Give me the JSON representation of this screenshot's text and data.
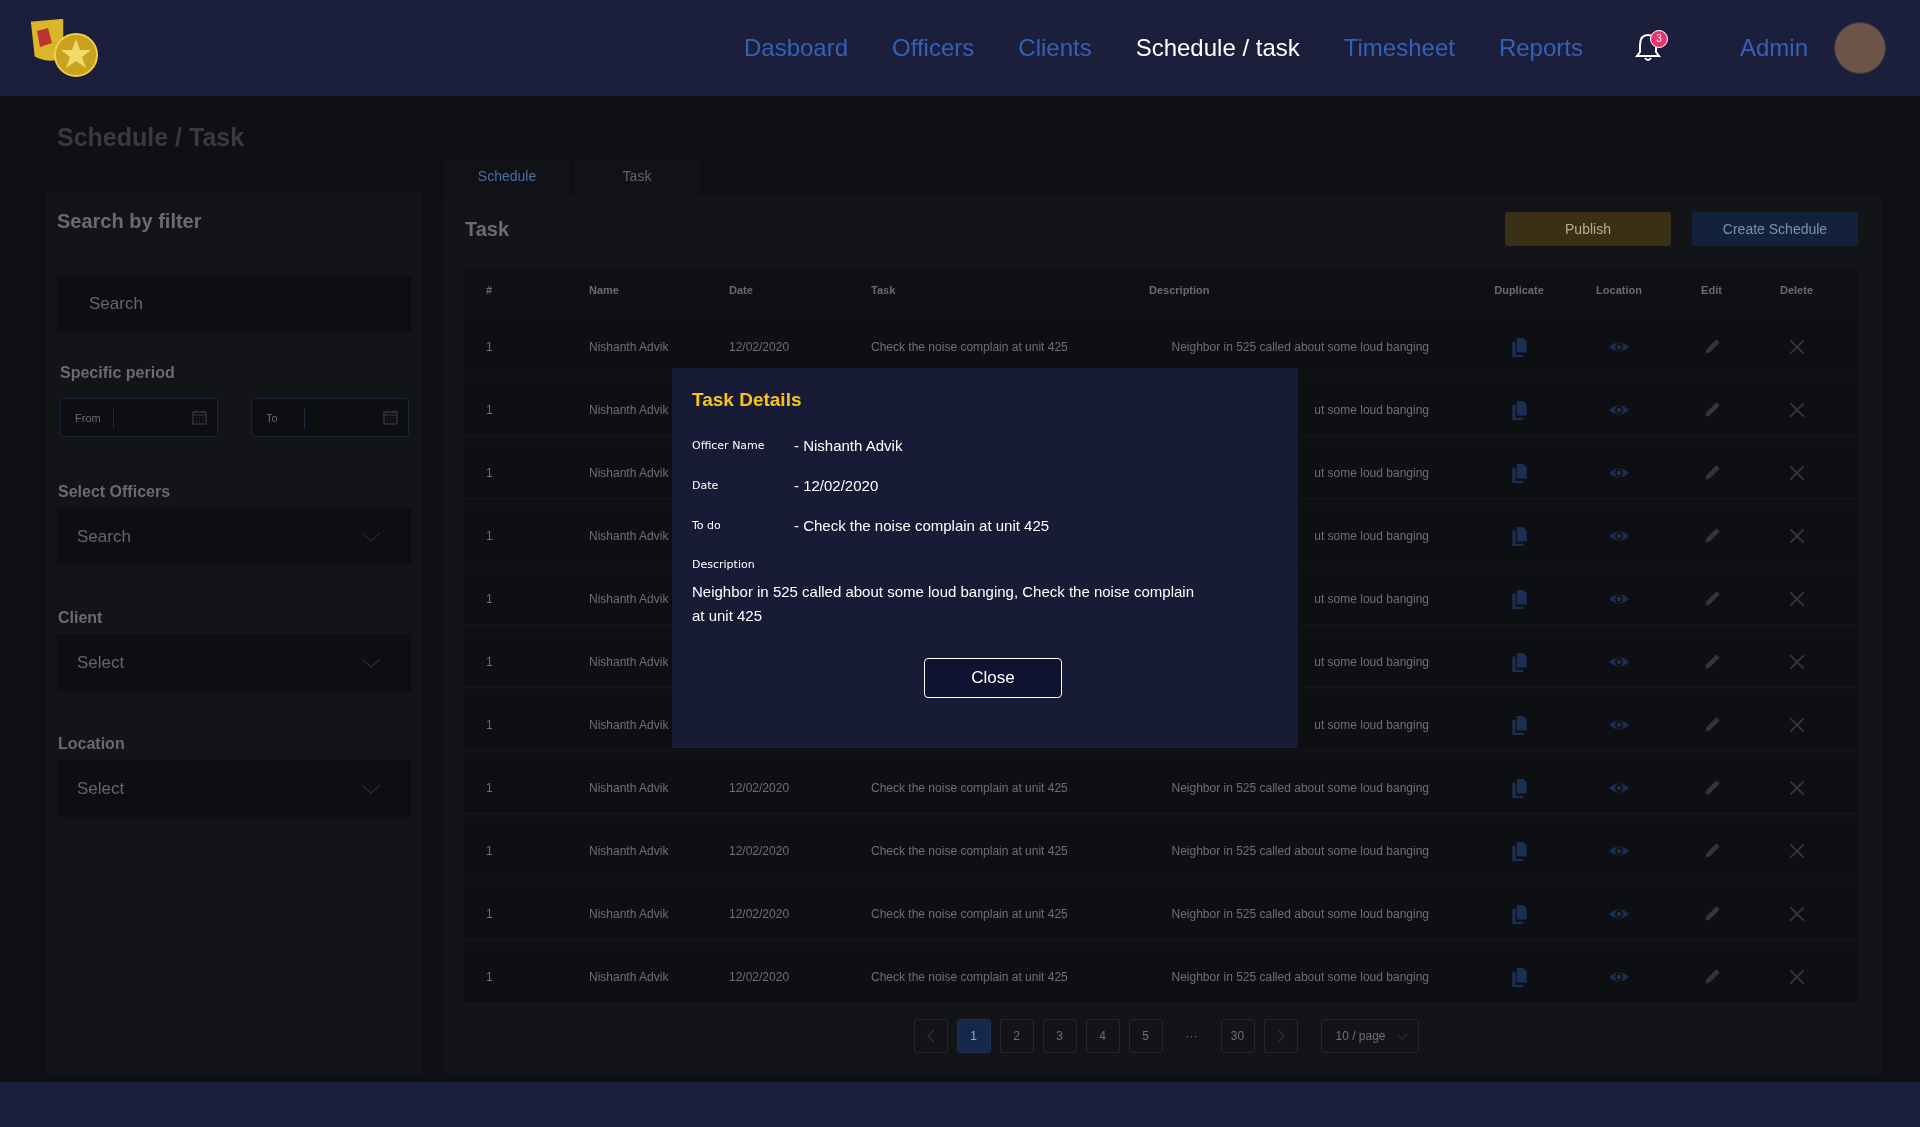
{
  "header": {
    "nav": [
      {
        "label": "Dasboard",
        "selected": false
      },
      {
        "label": "Officers",
        "selected": false
      },
      {
        "label": "Clients",
        "selected": false
      },
      {
        "label": "Schedule / task",
        "selected": true
      },
      {
        "label": "Timesheet",
        "selected": false
      },
      {
        "label": "Reports",
        "selected": false
      }
    ],
    "notifications": "3",
    "user": "Admin"
  },
  "page_title": "Schedule / Task",
  "filters": {
    "title": "Search by filter",
    "search": {
      "placeholder": "Search"
    },
    "period": {
      "label": "Specific period",
      "from": {
        "placeholder": "From"
      },
      "to": {
        "placeholder": "To"
      }
    },
    "selects": [
      {
        "label": "Select Officers",
        "placeholder": "Search"
      },
      {
        "label": "Client",
        "placeholder": "Select"
      },
      {
        "label": "Location",
        "placeholder": "Select"
      }
    ]
  },
  "tabs": [
    {
      "label": "Schedule",
      "selected": true
    },
    {
      "label": "Task",
      "selected": false
    }
  ],
  "panel": {
    "title": "Task",
    "buttons": [
      {
        "label": "Publish",
        "kind": "primary"
      },
      {
        "label": "Create Schedule",
        "kind": "secondary"
      }
    ]
  },
  "table": {
    "columns": [
      {
        "label": "#",
        "kind": "text"
      },
      {
        "label": "Name",
        "kind": "text"
      },
      {
        "label": "Date",
        "kind": "text"
      },
      {
        "label": "Task",
        "kind": "text"
      },
      {
        "label": "Description",
        "kind": "text"
      },
      {
        "label": "Duplicate",
        "kind": "duplicate"
      },
      {
        "label": "Location",
        "kind": "location"
      },
      {
        "label": "Edit",
        "kind": "edit"
      },
      {
        "label": "Delete",
        "kind": "delete"
      }
    ],
    "rows": [
      {
        "cells": [
          "1",
          "Nishanth Advik",
          "12/02/2020",
          "Check the noise complain at unit 425",
          "Neighbor in 525 called about some loud banging"
        ]
      },
      {
        "cells": [
          "1",
          "Nishanth Advik",
          null,
          null,
          "ut some loud banging"
        ]
      },
      {
        "cells": [
          "1",
          "Nishanth Advik",
          null,
          null,
          "ut some loud banging"
        ]
      },
      {
        "cells": [
          "1",
          "Nishanth Advik",
          null,
          null,
          "ut some loud banging"
        ]
      },
      {
        "cells": [
          "1",
          "Nishanth Advik",
          null,
          null,
          "ut some loud banging"
        ]
      },
      {
        "cells": [
          "1",
          "Nishanth Advik",
          null,
          null,
          "ut some loud banging"
        ]
      },
      {
        "cells": [
          "1",
          "Nishanth Advik",
          null,
          null,
          "ut some loud banging"
        ]
      },
      {
        "cells": [
          "1",
          "Nishanth Advik",
          "12/02/2020",
          "Check the noise complain at unit 425",
          "Neighbor in 525 called about some loud banging"
        ]
      },
      {
        "cells": [
          "1",
          "Nishanth Advik",
          "12/02/2020",
          "Check the noise complain at unit 425",
          "Neighbor in 525 called about some loud banging"
        ]
      },
      {
        "cells": [
          "1",
          "Nishanth Advik",
          "12/02/2020",
          "Check the noise complain at unit 425",
          "Neighbor in 525 called about some loud banging"
        ]
      },
      {
        "cells": [
          "1",
          "Nishanth Advik",
          "12/02/2020",
          "Check the noise complain at unit 425",
          "Neighbor in 525 called about some loud banging"
        ]
      }
    ]
  },
  "pagination": {
    "pages": [
      {
        "kind": "page",
        "label": "1",
        "selected": true
      },
      {
        "kind": "page",
        "label": "2",
        "selected": false
      },
      {
        "kind": "page",
        "label": "3",
        "selected": false
      },
      {
        "kind": "page",
        "label": "4",
        "selected": false
      },
      {
        "kind": "page",
        "label": "5",
        "selected": false
      },
      {
        "kind": "ellipsis",
        "label": "···",
        "selected": false
      },
      {
        "kind": "page",
        "label": "30",
        "selected": false
      }
    ],
    "page_size": "10 / page"
  },
  "modal": {
    "title": "Task Details",
    "fields": [
      {
        "label": "Officer Name",
        "value": "- Nishanth Advik"
      },
      {
        "label": "Date",
        "value": "- 12/02/2020"
      },
      {
        "label": "To do",
        "value": "- Check the noise complain at unit 425"
      }
    ],
    "description": {
      "label": "Description",
      "text": "Neighbor in 525 called about some loud banging, Check the noise complain at unit 425"
    },
    "button": "Close"
  }
}
